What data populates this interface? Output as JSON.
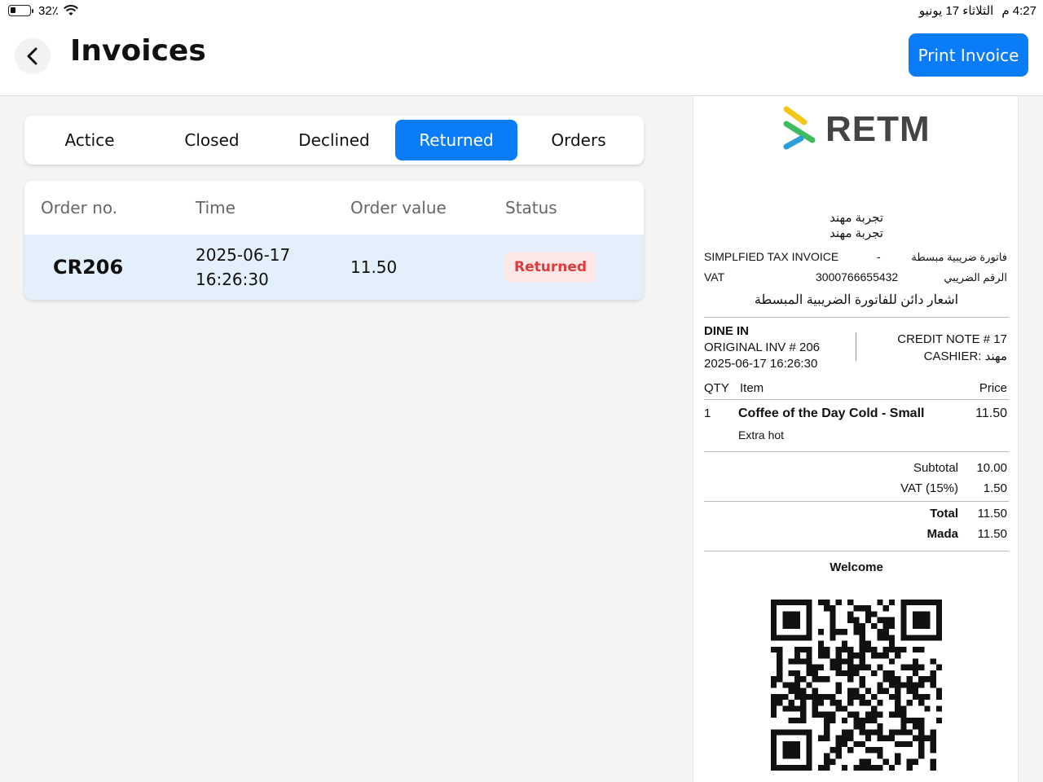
{
  "status_bar": {
    "battery": "32٪",
    "time": "4:27 م",
    "date": "الثلاثاء 17 يونيو"
  },
  "header": {
    "title": "Invoices",
    "print_button": "Print Invoice"
  },
  "tabs": [
    {
      "label": "Actice",
      "active": false
    },
    {
      "label": "Closed",
      "active": false
    },
    {
      "label": "Declined",
      "active": false
    },
    {
      "label": "Returned",
      "active": true
    },
    {
      "label": "Orders",
      "active": false
    }
  ],
  "table": {
    "headers": [
      "Order no.",
      "Time",
      "Order value",
      "Status"
    ],
    "rows": [
      {
        "order_no": "CR206",
        "date": "2025-06-17",
        "time": "16:26:30",
        "value": "11.50",
        "status": "Returned"
      }
    ]
  },
  "receipt": {
    "logo": "RETM",
    "store_name_1": "تجربة مهند",
    "store_name_2": "تجربة مهند",
    "invoice_type_en": "SIMPLFIED TAX INVOICE",
    "invoice_type_sep": "-",
    "invoice_type_ar": "فاتورة ضريبية مبسطة",
    "vat_label_en": "VAT",
    "vat_number": "3000766655432",
    "vat_label_ar": "الرقم الضريبي",
    "credit_title_ar": "اشعار دائن للفاتورة الضريبية المبسطة",
    "order_type": "DINE IN",
    "original_inv": "ORIGINAL INV # 206",
    "datetime": "2025-06-17 16:26:30",
    "credit_note": "CREDIT NOTE # 17",
    "cashier": "CASHIER: مهند",
    "items_header": {
      "qty": "QTY",
      "item": "Item",
      "price": "Price"
    },
    "items": [
      {
        "qty": "1",
        "name": "Coffee of the Day Cold - Small",
        "price": "11.50",
        "note": "Extra hot"
      }
    ],
    "subtotal_label": "Subtotal",
    "subtotal": "10.00",
    "vat_pct_label": "VAT (15%)",
    "vat_amount": "1.50",
    "total_label": "Total",
    "total": "11.50",
    "payment_label": "Mada",
    "payment": "11.50",
    "footer": "Welcome"
  },
  "colors": {
    "accent": "#0a7cf7",
    "row_highlight": "#e4effc",
    "badge_bg": "#fde6e6",
    "badge_text": "#e03a3a",
    "logo_yellow": "#f5c518",
    "logo_green": "#3dbb5e",
    "logo_blue": "#2a9fd8"
  }
}
